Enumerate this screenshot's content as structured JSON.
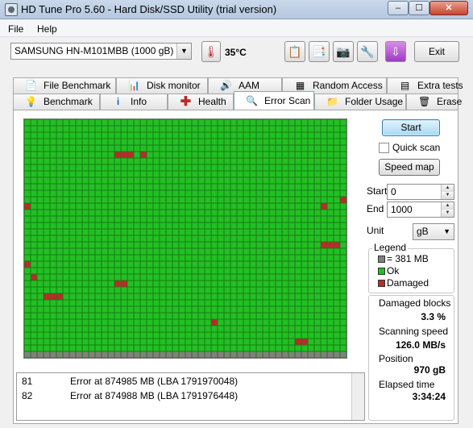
{
  "window": {
    "title": "HD Tune Pro 5.60 - Hard Disk/SSD Utility (trial version)",
    "min_glyph": "–",
    "max_glyph": "☐",
    "close_glyph": "✕"
  },
  "menu": {
    "file": "File",
    "help": "Help"
  },
  "toolbar": {
    "drive": "SAMSUNG HN-M101MBB (1000 gB)",
    "temperature": "35°C",
    "exit_label": "Exit",
    "icons": [
      "copy-info-icon",
      "copy-log-icon",
      "screenshot-camera-icon",
      "settings-icon",
      "save-download-icon"
    ]
  },
  "tabs": {
    "row1": [
      "File Benchmark",
      "Disk monitor",
      "AAM",
      "Random Access",
      "Extra tests"
    ],
    "row2": [
      "Benchmark",
      "Info",
      "Health",
      "Error Scan",
      "Folder Usage",
      "Erase"
    ],
    "active": "Error Scan"
  },
  "controls": {
    "start_label": "Start",
    "quick_scan_label": "Quick scan",
    "quick_scan_checked": false,
    "speed_map_label": "Speed map",
    "start_field_label": "Start",
    "start_value": "0",
    "end_field_label": "End",
    "end_value": "1000",
    "unit_label": "Unit",
    "unit_value": "gB"
  },
  "legend": {
    "title": "Legend",
    "items": [
      {
        "label": "= 381 MB",
        "color": "#808080"
      },
      {
        "label": "Ok",
        "color": "#22c022"
      },
      {
        "label": "Damaged",
        "color": "#c0282a"
      }
    ]
  },
  "stats": {
    "damaged_blocks_label": "Damaged blocks",
    "damaged_blocks_value": "3.3 %",
    "scanning_speed_label": "Scanning speed",
    "scanning_speed_value": "126.0 MB/s",
    "position_label": "Position",
    "position_value": "970 gB",
    "elapsed_label": "Elapsed time",
    "elapsed_value": "3:34:24"
  },
  "log": [
    {
      "num": "81",
      "msg": "Error at 874985 MB (LBA 1791970048)"
    },
    {
      "num": "82",
      "msg": "Error at 874988 MB (LBA 1791976448)"
    }
  ],
  "scan_map": {
    "columns": 50,
    "rows": 37,
    "ok_color": "#22c022",
    "damaged_color": "#c0282a",
    "pending_color": "#808080",
    "grid_line_color": "#1a7a1a",
    "damaged_cells": [
      [
        5,
        14
      ],
      [
        5,
        15
      ],
      [
        5,
        16
      ],
      [
        5,
        18
      ],
      [
        13,
        0
      ],
      [
        13,
        46
      ],
      [
        12,
        49
      ],
      [
        19,
        46
      ],
      [
        19,
        47
      ],
      [
        19,
        48
      ],
      [
        22,
        0
      ],
      [
        24,
        1
      ],
      [
        25,
        14
      ],
      [
        25,
        15
      ],
      [
        27,
        3
      ],
      [
        27,
        4
      ],
      [
        27,
        5
      ],
      [
        31,
        29
      ],
      [
        34,
        42
      ],
      [
        34,
        43
      ]
    ],
    "pending_row": 36,
    "pending_cells_from_col": 0
  }
}
